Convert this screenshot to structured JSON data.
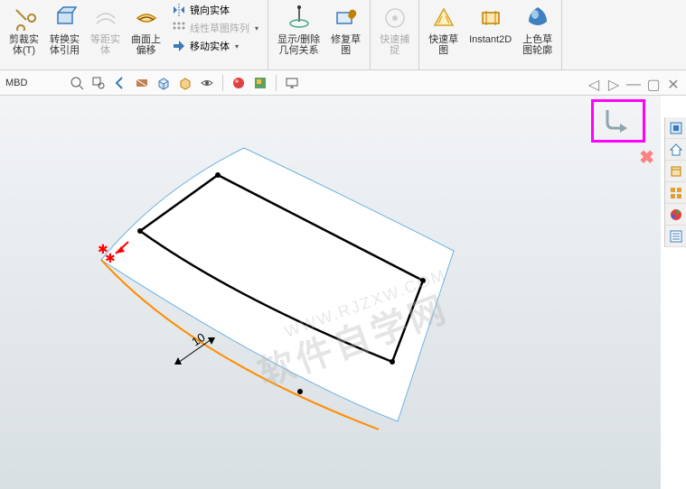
{
  "ribbon": {
    "trim_entities": "剪裁实\n体(T)",
    "convert_entities": "转换实\n体引用",
    "offset_entities": "等距实\n体",
    "offset_on_surface": "曲面上\n偏移",
    "mirror_entities": "镜向实体",
    "linear_pattern": "线性草图阵列",
    "move_entities": "移动实体",
    "display_relations": "显示/删除\n几何关系",
    "repair_sketch": "修复草\n图",
    "quick_snap": "快速捕\n捉",
    "rapid_sketch": "快速草\n图",
    "instant2d": "Instant2D",
    "shaded_sketch": "上色草\n图轮廓"
  },
  "subbar": {
    "tab": "MBD"
  },
  "viewport": {
    "dimension_value": "10"
  },
  "watermark": {
    "main": "软件自学网",
    "sub": "WWW.RJZXW.COM"
  }
}
